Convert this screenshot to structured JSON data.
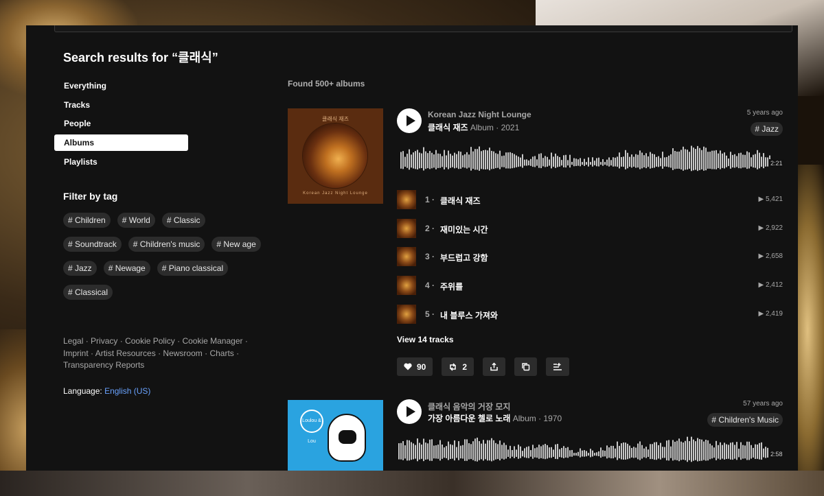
{
  "search": {
    "title": "Search results for “클래식”",
    "found": "Found 500+ albums"
  },
  "nav": {
    "items": [
      {
        "label": "Everything",
        "active": false
      },
      {
        "label": "Tracks",
        "active": false
      },
      {
        "label": "People",
        "active": false
      },
      {
        "label": "Albums",
        "active": true
      },
      {
        "label": "Playlists",
        "active": false
      }
    ]
  },
  "filter": {
    "title": "Filter by tag",
    "tags": [
      "# Children",
      "# World",
      "# Classic",
      "# Soundtrack",
      "# Children's music",
      "# New age",
      "# Jazz",
      "# Newage",
      "# Piano classical",
      "# Classical"
    ]
  },
  "footer": {
    "links": [
      "Legal",
      "Privacy",
      "Cookie Policy",
      "Cookie Manager",
      "Imprint",
      "Artist Resources",
      "Newsroom",
      "Charts",
      "Transparency Reports"
    ],
    "language_label": "Language:",
    "language_value": "English (US)"
  },
  "albums": [
    {
      "cover_title": "클래식 재즈",
      "cover_subtitle": "Korean Jazz Night Lounge",
      "artist": "Korean Jazz Night Lounge",
      "title": "클래식 재즈",
      "meta": "Album · 2021",
      "age": "5 years ago",
      "genre": "# Jazz",
      "duration": "2:21",
      "tracks": [
        {
          "num": "1 ·",
          "name": "클래식 재즈",
          "plays": "▶ 5,421"
        },
        {
          "num": "2 ·",
          "name": "재미있는 시간",
          "plays": "▶ 2,922"
        },
        {
          "num": "3 ·",
          "name": "부드럽고 강함",
          "plays": "▶ 2,658"
        },
        {
          "num": "4 ·",
          "name": "주위를",
          "plays": "▶ 2,412"
        },
        {
          "num": "5 ·",
          "name": "내 블루스 가져와",
          "plays": "▶ 2,419"
        }
      ],
      "view_tracks": "View 14 tracks",
      "likes": "90",
      "reposts": "2"
    },
    {
      "cover_badge": "Loulou & Lou",
      "artist": "클래식 음악의 거장 모지",
      "title": "가장 아름다운 첼로 노래",
      "meta": "Album · 1970",
      "age": "57 years ago",
      "genre": "# Children's Music",
      "duration": "2:58"
    }
  ],
  "colors": {
    "panel": "#121212",
    "active_nav": "#ffffff",
    "link": "#6aa3ff",
    "tag_bg": "#2c2c2c"
  }
}
